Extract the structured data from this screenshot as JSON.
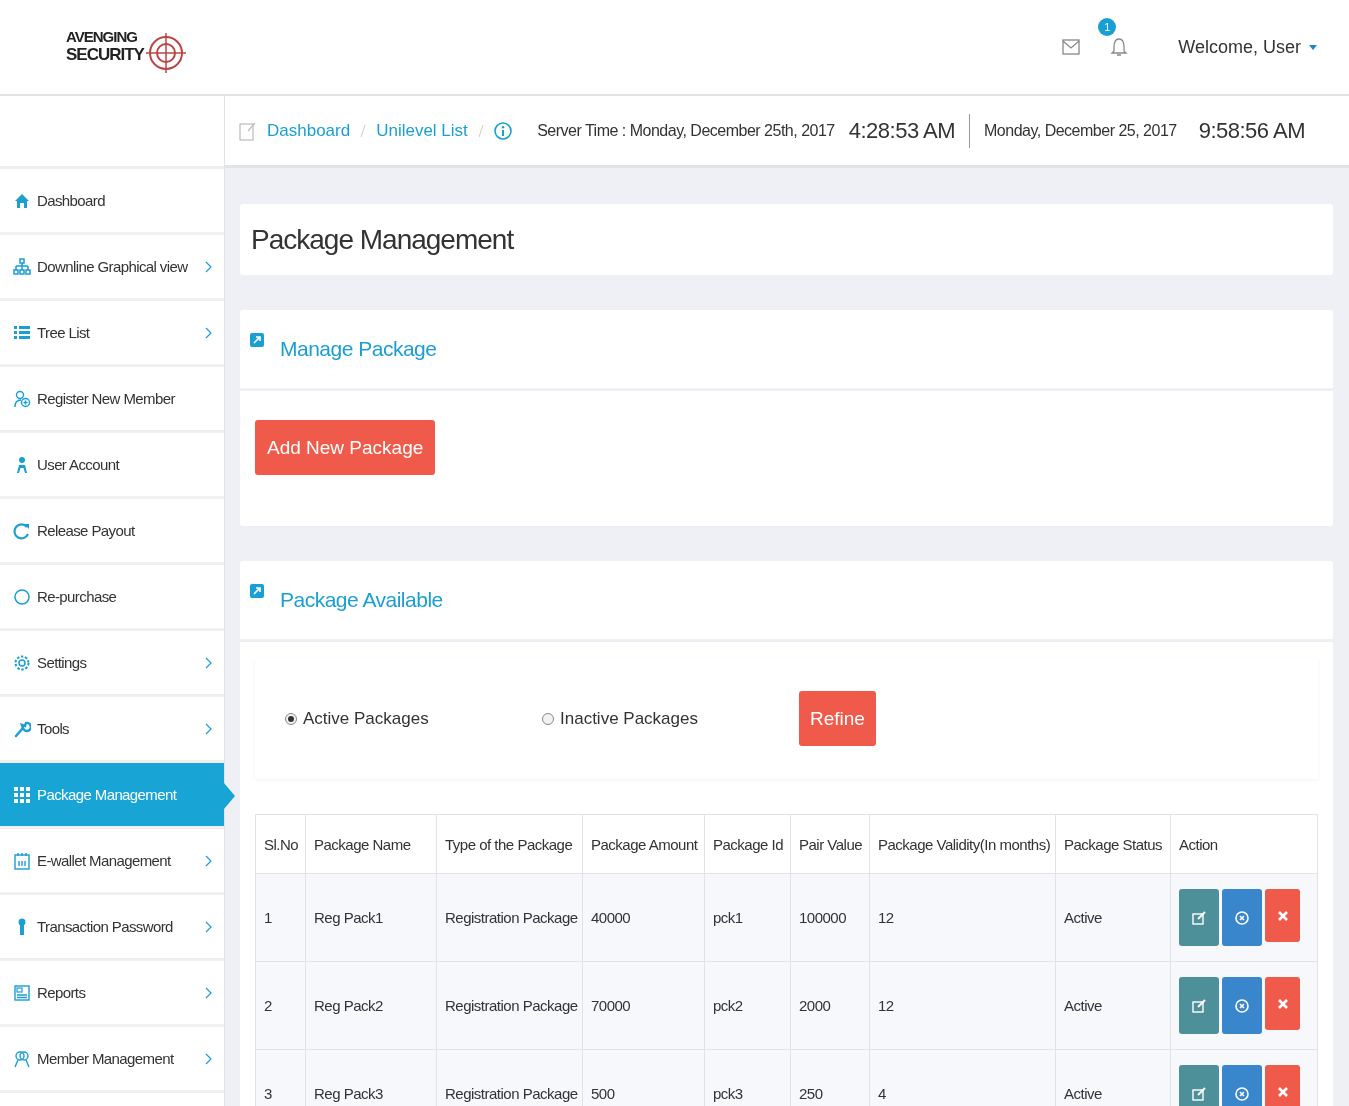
{
  "logo": {
    "line_1": "AVENGING",
    "line_2": "SECURITY"
  },
  "header": {
    "notification_count": "1",
    "welcome": "Welcome, User"
  },
  "breadcrumb": [
    {
      "label": "Dashboard"
    },
    {
      "label": "Unilevel List"
    }
  ],
  "clock": {
    "server_time": "Server Time : Monday, December 25th, 2017",
    "server_clock": "4:28:53 AM",
    "local_date": "Monday, December 25, 2017",
    "local_clock": "9:58:56 AM"
  },
  "sidebar": {
    "items": [
      {
        "label": "Dashboard",
        "submenu": false,
        "selected": false
      },
      {
        "label": "Downline Graphical view",
        "submenu": true,
        "selected": false
      },
      {
        "label": "Tree List",
        "submenu": true,
        "selected": false
      },
      {
        "label": "Register New Member",
        "submenu": false,
        "selected": false
      },
      {
        "label": "User Account",
        "submenu": false,
        "selected": false
      },
      {
        "label": "Release Payout",
        "submenu": false,
        "selected": false
      },
      {
        "label": "Re-purchase",
        "submenu": false,
        "selected": false
      },
      {
        "label": "Settings",
        "submenu": true,
        "selected": false
      },
      {
        "label": "Tools",
        "submenu": true,
        "selected": false
      },
      {
        "label": "Package Management",
        "submenu": false,
        "selected": true
      },
      {
        "label": "E-wallet Management",
        "submenu": true,
        "selected": false
      },
      {
        "label": "Transaction Password",
        "submenu": true,
        "selected": false
      },
      {
        "label": "Reports",
        "submenu": true,
        "selected": false
      },
      {
        "label": "Member Management",
        "submenu": true,
        "selected": false
      }
    ]
  },
  "page_title": "Package Management",
  "manage_panel": {
    "title": "Manage Package",
    "button": "Add New Package"
  },
  "available_panel": {
    "title": "Package Available",
    "filter": {
      "options": [
        {
          "label": "Active Packages",
          "selected": true
        },
        {
          "label": "Inactive Packages",
          "selected": false
        }
      ],
      "button": "Refine"
    },
    "table": {
      "columns": [
        "Sl.No",
        "Package Name",
        "Type of the Package",
        "Package Amount",
        "Package Id",
        "Pair Value",
        "Package Validity(In months)",
        "Package Status",
        "Action"
      ],
      "rows": [
        [
          "1",
          "Reg Pack1",
          "Registration Package",
          "40000",
          "pck1",
          "100000",
          "12",
          "Active"
        ],
        [
          "2",
          "Reg Pack2",
          "Registration Package",
          "70000",
          "pck2",
          "2000",
          "12",
          "Active"
        ],
        [
          "3",
          "Reg Pack3",
          "Registration Package",
          "500",
          "pck3",
          "250",
          "4",
          "Active"
        ]
      ]
    }
  }
}
